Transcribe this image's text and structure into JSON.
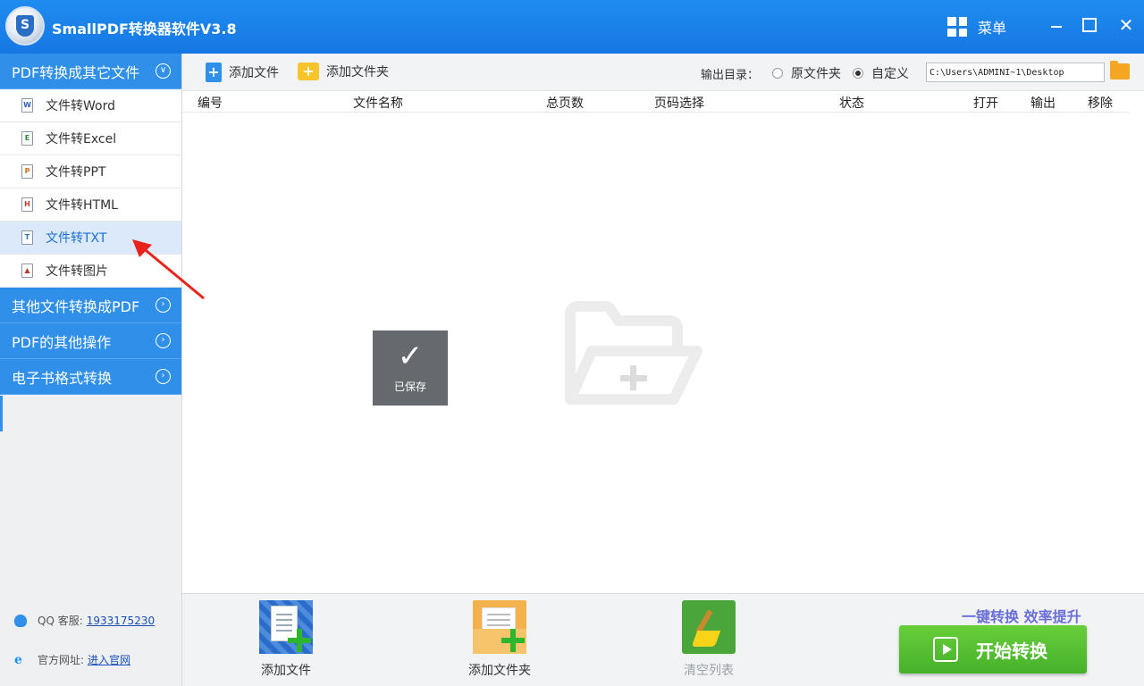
{
  "window": {
    "title": "SmallPDF转换器软件V3.8",
    "menu_label": "菜单",
    "close_glyph": "✕"
  },
  "sidebar": {
    "categories": [
      {
        "label": "PDF转换成其它文件",
        "expanded": true
      },
      {
        "label": "其他文件转换成PDF",
        "expanded": false
      },
      {
        "label": "PDF的其他操作",
        "expanded": false
      },
      {
        "label": "电子书格式转换",
        "expanded": false
      }
    ],
    "items": [
      {
        "label": "文件转Word",
        "icon": "word-file-icon",
        "glyph": "W"
      },
      {
        "label": "文件转Excel",
        "icon": "excel-file-icon",
        "glyph": "E"
      },
      {
        "label": "文件转PPT",
        "icon": "ppt-file-icon",
        "glyph": "P"
      },
      {
        "label": "文件转HTML",
        "icon": "html-file-icon",
        "glyph": "H"
      },
      {
        "label": "文件转TXT",
        "icon": "txt-file-icon",
        "glyph": "T",
        "active": true
      },
      {
        "label": "文件转图片",
        "icon": "image-file-icon",
        "glyph": "▲"
      }
    ],
    "contact": {
      "qq_label": "QQ 客服:",
      "qq_number": "1933175230",
      "site_label": "官方网址:",
      "site_link": "进入官网",
      "ie_glyph": "e"
    }
  },
  "toolbar": {
    "add_file": "添加文件",
    "add_folder": "添加文件夹",
    "add_glyph": "+",
    "output_label": "输出目录：",
    "radio_original": "原文件夹",
    "radio_custom": "自定义",
    "selected_radio": "自定义",
    "output_path": "C:\\Users\\ADMINI~1\\Desktop"
  },
  "table": {
    "columns": [
      "编号",
      "文件名称",
      "总页数",
      "页码选择",
      "状态",
      "打开",
      "输出",
      "移除"
    ]
  },
  "toast": {
    "check_glyph": "✓",
    "text": "已保存"
  },
  "bottom": {
    "add_file": "添加文件",
    "add_folder": "添加文件夹",
    "clear_list": "清空列表",
    "slogan": "一键转换  效率提升",
    "start": "开始转换"
  },
  "colors": {
    "titlebar": "#1f8cf0",
    "sidebar_category": "#2f8fe9",
    "active_item_bg": "#dbe9fb",
    "start_button": "#45b02a",
    "slogan": "#6a6fd8"
  }
}
